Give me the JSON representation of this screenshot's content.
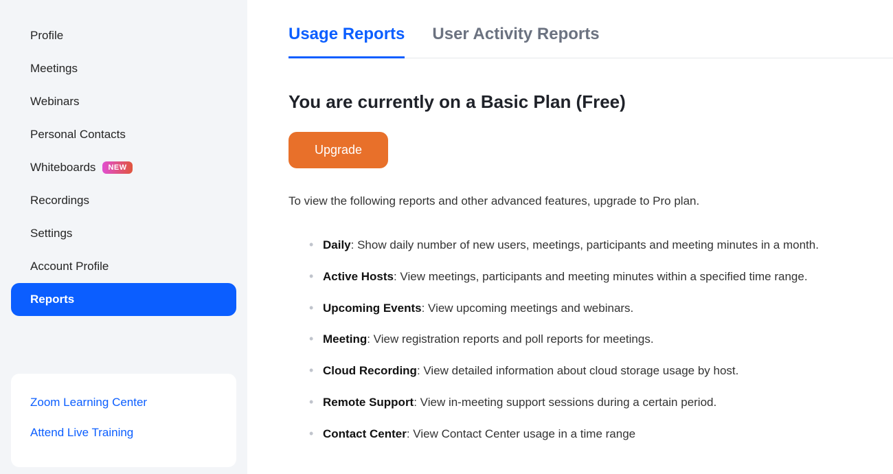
{
  "sidebar": {
    "items": [
      {
        "label": "Profile",
        "active": false,
        "badge": null
      },
      {
        "label": "Meetings",
        "active": false,
        "badge": null
      },
      {
        "label": "Webinars",
        "active": false,
        "badge": null
      },
      {
        "label": "Personal Contacts",
        "active": false,
        "badge": null
      },
      {
        "label": "Whiteboards",
        "active": false,
        "badge": "NEW"
      },
      {
        "label": "Recordings",
        "active": false,
        "badge": null
      },
      {
        "label": "Settings",
        "active": false,
        "badge": null
      },
      {
        "label": "Account Profile",
        "active": false,
        "badge": null
      },
      {
        "label": "Reports",
        "active": true,
        "badge": null
      }
    ],
    "secondary_links": [
      {
        "label": "Zoom Learning Center"
      },
      {
        "label": "Attend Live Training"
      }
    ]
  },
  "main": {
    "tabs": [
      {
        "label": "Usage Reports",
        "active": true
      },
      {
        "label": "User Activity Reports",
        "active": false
      }
    ],
    "plan_heading": "You are currently on a Basic Plan (Free)",
    "upgrade_button": "Upgrade",
    "upgrade_description": "To view the following reports and other advanced features, upgrade to Pro plan.",
    "reports": [
      {
        "name": "Daily",
        "desc": ": Show daily number of new users, meetings, participants and meeting minutes in a month."
      },
      {
        "name": "Active Hosts",
        "desc": ": View meetings, participants and meeting minutes within a specified time range."
      },
      {
        "name": "Upcoming Events",
        "desc": ": View upcoming meetings and webinars."
      },
      {
        "name": "Meeting",
        "desc": ": View registration reports and poll reports for meetings."
      },
      {
        "name": "Cloud Recording",
        "desc": ": View detailed information about cloud storage usage by host."
      },
      {
        "name": "Remote Support",
        "desc": ": View in-meeting support sessions during a certain period."
      },
      {
        "name": "Contact Center",
        "desc": ": View Contact Center usage in a time range"
      }
    ]
  }
}
